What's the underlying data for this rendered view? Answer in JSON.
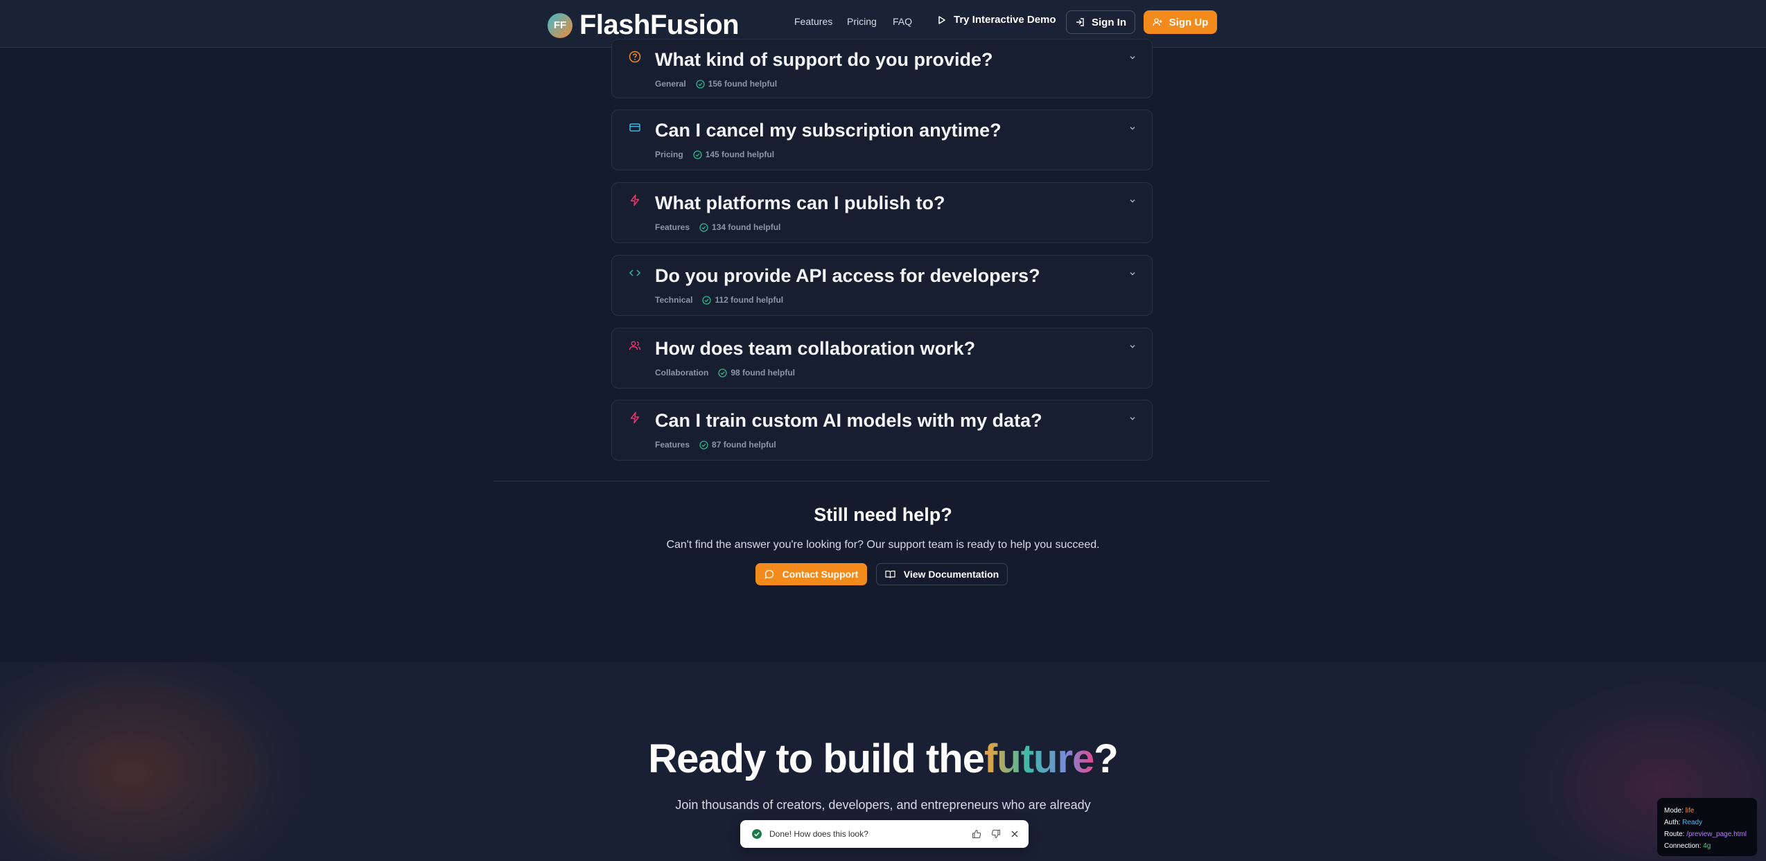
{
  "nav": {
    "logo_badge": "FF",
    "logo_text": "FlashFusion",
    "links": [
      "Features",
      "Pricing",
      "FAQ"
    ],
    "demo_label": "Try Interactive Demo",
    "signin_label": "Sign In",
    "signup_label": "Sign Up"
  },
  "faq": {
    "items": [
      {
        "question": "What kind of support do you provide?",
        "category": "General",
        "helpful": "156 found helpful",
        "icon": "help-circle-icon",
        "color": "#f28a1c"
      },
      {
        "question": "Can I cancel my subscription anytime?",
        "category": "Pricing",
        "helpful": "145 found helpful",
        "icon": "credit-card-icon",
        "color": "#3fb8e0"
      },
      {
        "question": "What platforms can I publish to?",
        "category": "Features",
        "helpful": "134 found helpful",
        "icon": "zap-icon",
        "color": "#e8366e"
      },
      {
        "question": "Do you provide API access for developers?",
        "category": "Technical",
        "helpful": "112 found helpful",
        "icon": "code-icon",
        "color": "#2bb5a0"
      },
      {
        "question": "How does team collaboration work?",
        "category": "Collaboration",
        "helpful": "98 found helpful",
        "icon": "users-icon",
        "color": "#e8366e"
      },
      {
        "question": "Can I train custom AI models with my data?",
        "category": "Features",
        "helpful": "87 found helpful",
        "icon": "zap-icon",
        "color": "#e8366e"
      }
    ]
  },
  "help": {
    "title": "Still need help?",
    "subtitle": "Can't find the answer you're looking for? Our support team is ready to help you succeed.",
    "contact_label": "Contact Support",
    "docs_label": "View Documentation"
  },
  "cta": {
    "title_prefix": "Ready to build the",
    "title_highlight": "future",
    "title_suffix": "?",
    "subtitle": "Join thousands of creators, developers, and entrepreneurs who are already"
  },
  "toast": {
    "text": "Done! How does this look?"
  },
  "debug": {
    "mode_label": "Mode:",
    "mode_value": "life",
    "auth_label": "Auth:",
    "auth_value": "Ready",
    "route_label": "Route:",
    "route_value": "/preview_page.html",
    "connection_label": "Connection:",
    "connection_value": "4g"
  },
  "colors": {
    "accent": "#f28a1c",
    "background": "#141b2d"
  }
}
